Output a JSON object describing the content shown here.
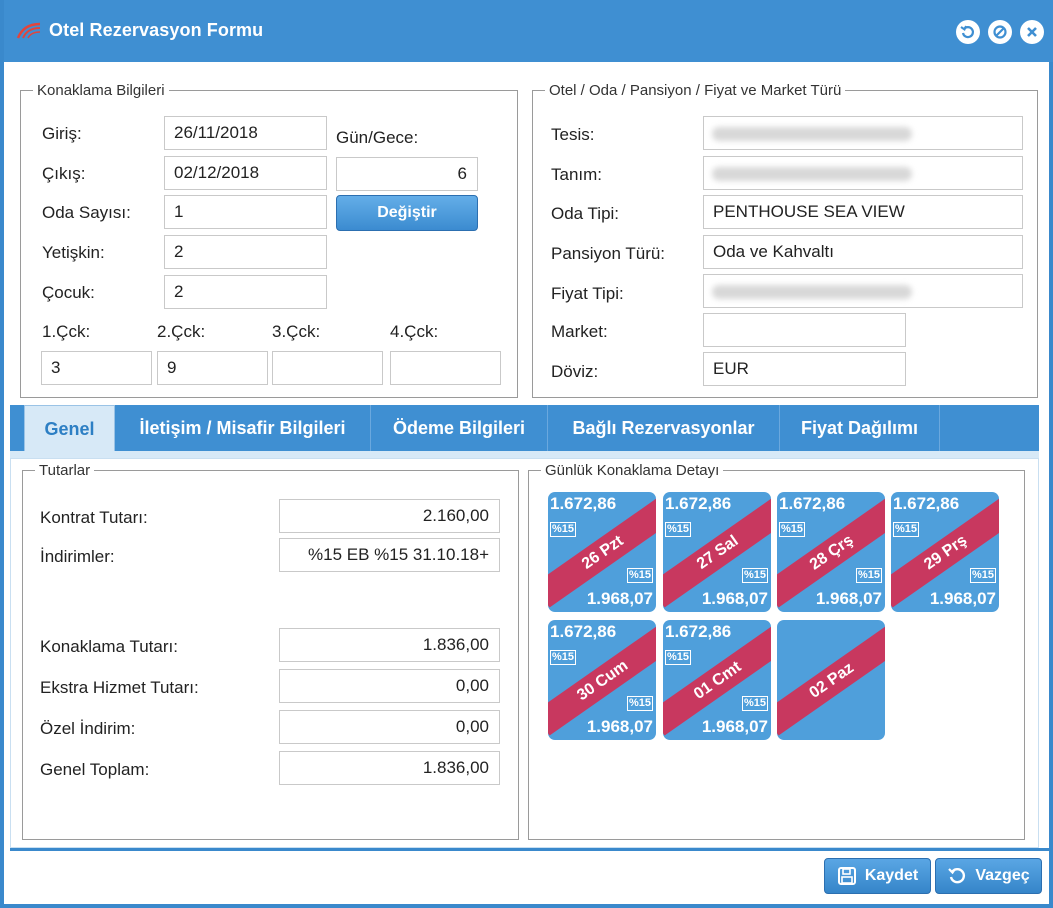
{
  "window": {
    "title": "Otel Rezervasyon Formu"
  },
  "stay": {
    "legend": "Konaklama Bilgileri",
    "checkin_label": "Giriş:",
    "checkin_value": "26/11/2018",
    "checkout_label": "Çıkış:",
    "checkout_value": "02/12/2018",
    "nights_label": "Gün/Gece:",
    "nights_value": "6",
    "rooms_label": "Oda Sayısı:",
    "rooms_value": "1",
    "change_button": "Değiştir",
    "adults_label": "Yetişkin:",
    "adults_value": "2",
    "children_label": "Çocuk:",
    "children_value": "2",
    "child_ages": [
      {
        "label": "1.Çck:",
        "value": "3"
      },
      {
        "label": "2.Çck:",
        "value": "9"
      },
      {
        "label": "3.Çck:",
        "value": ""
      },
      {
        "label": "4.Çck:",
        "value": ""
      }
    ]
  },
  "hotel": {
    "legend": "Otel / Oda / Pansiyon / Fiyat ve Market Türü",
    "facility_label": "Tesis:",
    "definition_label": "Tanım:",
    "room_type_label": "Oda Tipi:",
    "room_type_value": "PENTHOUSE SEA VIEW",
    "board_label": "Pansiyon Türü:",
    "board_value": "Oda ve Kahvaltı",
    "price_type_label": "Fiyat Tipi:",
    "market_label": "Market:",
    "market_value": "",
    "currency_label": "Döviz:",
    "currency_value": "EUR"
  },
  "tabs": [
    {
      "label": "Genel"
    },
    {
      "label": "İletişim / Misafir Bilgileri"
    },
    {
      "label": "Ödeme Bilgileri"
    },
    {
      "label": "Bağlı Rezervasyonlar"
    },
    {
      "label": "Fiyat Dağılımı"
    }
  ],
  "amounts": {
    "legend": "Tutarlar",
    "contract_label": "Kontrat Tutarı:",
    "contract_value": "2.160,00",
    "discounts_label": "İndirimler:",
    "discounts_value": "%15 EB %15 31.10.18+",
    "stay_label": "Konaklama Tutarı:",
    "stay_value": "1.836,00",
    "extra_label": "Ekstra Hizmet Tutarı:",
    "extra_value": "0,00",
    "special_label": "Özel İndirim:",
    "special_value": "0,00",
    "total_label": "Genel Toplam:",
    "total_value": "1.836,00"
  },
  "daily": {
    "legend": "Günlük Konaklama Detayı",
    "days": [
      {
        "top": "1.672,86",
        "pct_top": "%15",
        "ribbon": "26 Pzt",
        "pct_bottom": "%15",
        "bottom": "1.968,07"
      },
      {
        "top": "1.672,86",
        "pct_top": "%15",
        "ribbon": "27 Sal",
        "pct_bottom": "%15",
        "bottom": "1.968,07"
      },
      {
        "top": "1.672,86",
        "pct_top": "%15",
        "ribbon": "28 Çrş",
        "pct_bottom": "%15",
        "bottom": "1.968,07"
      },
      {
        "top": "1.672,86",
        "pct_top": "%15",
        "ribbon": "29 Prş",
        "pct_bottom": "%15",
        "bottom": "1.968,07"
      },
      {
        "top": "1.672,86",
        "pct_top": "%15",
        "ribbon": "30 Cum",
        "pct_bottom": "%15",
        "bottom": "1.968,07"
      },
      {
        "top": "1.672,86",
        "pct_top": "%15",
        "ribbon": "01 Cmt",
        "pct_bottom": "%15",
        "bottom": "1.968,07"
      },
      {
        "top": "",
        "pct_top": "",
        "ribbon": "02 Paz",
        "pct_bottom": "",
        "bottom": ""
      }
    ]
  },
  "footer": {
    "save_label": "Kaydet",
    "cancel_label": "Vazgeç"
  },
  "colors": {
    "accent": "#3f8fd2",
    "tab_active_bg": "#d7e9f7",
    "day_tile": "#4f9fdb",
    "ribbon": "#c8385f"
  }
}
